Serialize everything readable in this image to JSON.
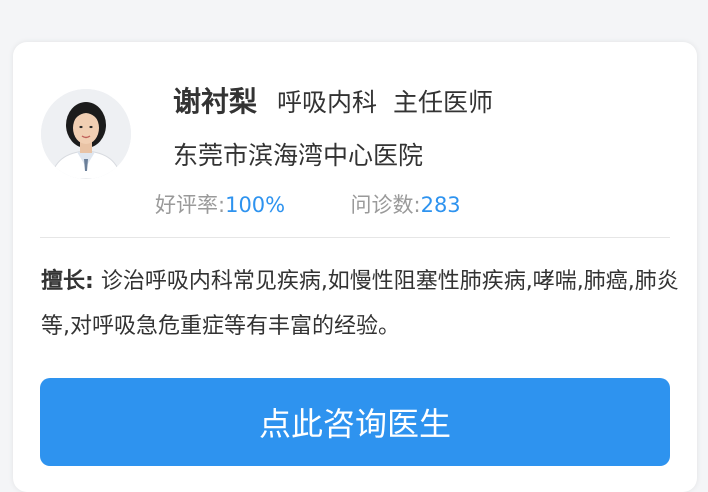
{
  "doctor": {
    "name": "谢衬梨",
    "department": "呼吸内科",
    "title": "主任医师",
    "hospital": "东莞市滨海湾中心医院",
    "avatar_icon": "doctor-portrait"
  },
  "stats": {
    "rating_label": "好评率:",
    "rating_value": "100%",
    "consult_label": "问诊数:",
    "consult_value": "283"
  },
  "expertise": {
    "label": "擅长:",
    "text": "诊治呼吸内科常见疾病,如慢性阻塞性肺疾病,哮喘,肺癌,肺炎等,对呼吸急危重症等有丰富的经验。"
  },
  "actions": {
    "consult_button": "点此咨询医生"
  },
  "colors": {
    "accent": "#2e93ef",
    "text": "#333333",
    "muted": "#9a9a9a"
  }
}
